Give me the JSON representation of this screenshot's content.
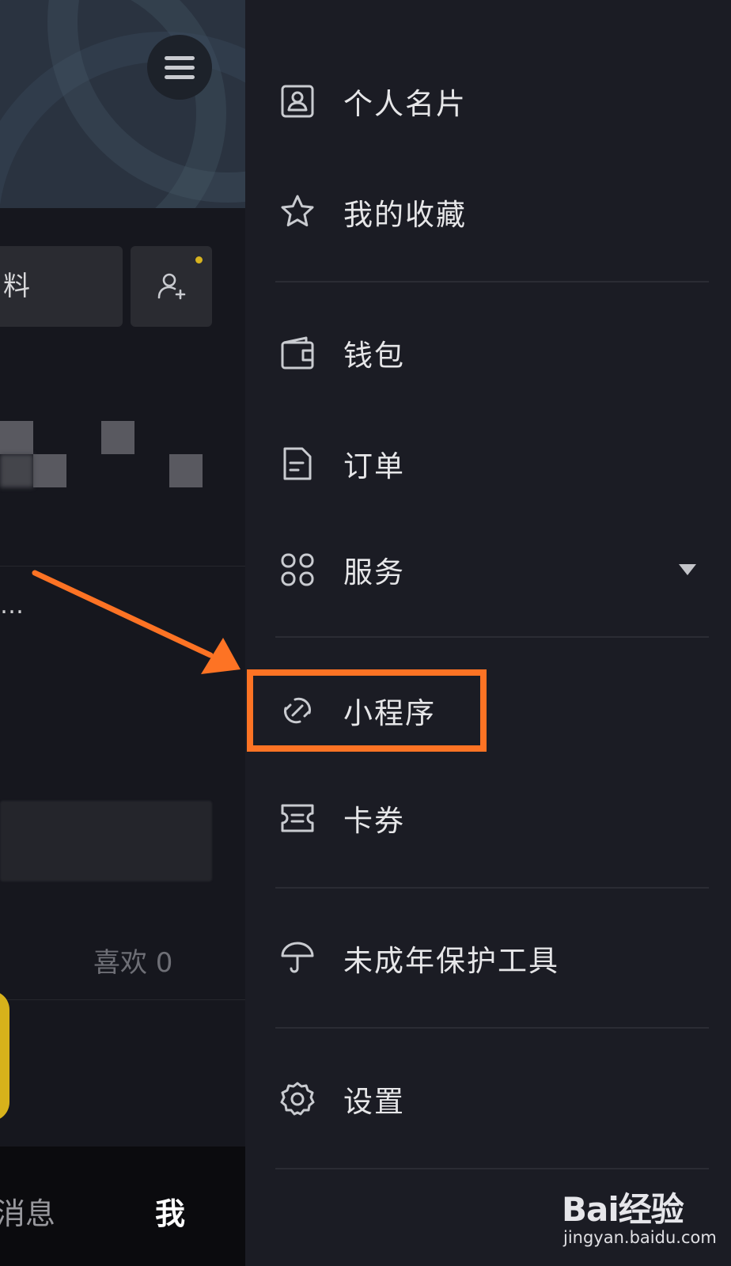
{
  "left_page": {
    "edit_profile_fragment": "料",
    "ellipsis": "…",
    "likes_text": "喜欢 0",
    "tabs": {
      "messages": "消息",
      "me": "我"
    }
  },
  "drawer": {
    "items": [
      {
        "label": "个人名片",
        "icon": "profile-card-icon"
      },
      {
        "label": "我的收藏",
        "icon": "star-icon"
      },
      {
        "label": "钱包",
        "icon": "wallet-icon"
      },
      {
        "label": "订单",
        "icon": "order-document-icon"
      },
      {
        "label": "服务",
        "icon": "services-grid-icon"
      },
      {
        "label": "小程序",
        "icon": "mini-program-link-icon"
      },
      {
        "label": "卡券",
        "icon": "coupon-ticket-icon"
      },
      {
        "label": "未成年保护工具",
        "icon": "umbrella-icon"
      },
      {
        "label": "设置",
        "icon": "gear-icon"
      }
    ]
  },
  "annotation": {
    "highlight_color": "#fd7324",
    "target": "小程序"
  },
  "watermark": {
    "logo": "Bai经验",
    "url": "jingyan.baidu.com"
  },
  "colors": {
    "drawer_bg": "#1b1c24",
    "accent_yellow": "#d7b21b",
    "annotation_orange": "#fd7324"
  }
}
